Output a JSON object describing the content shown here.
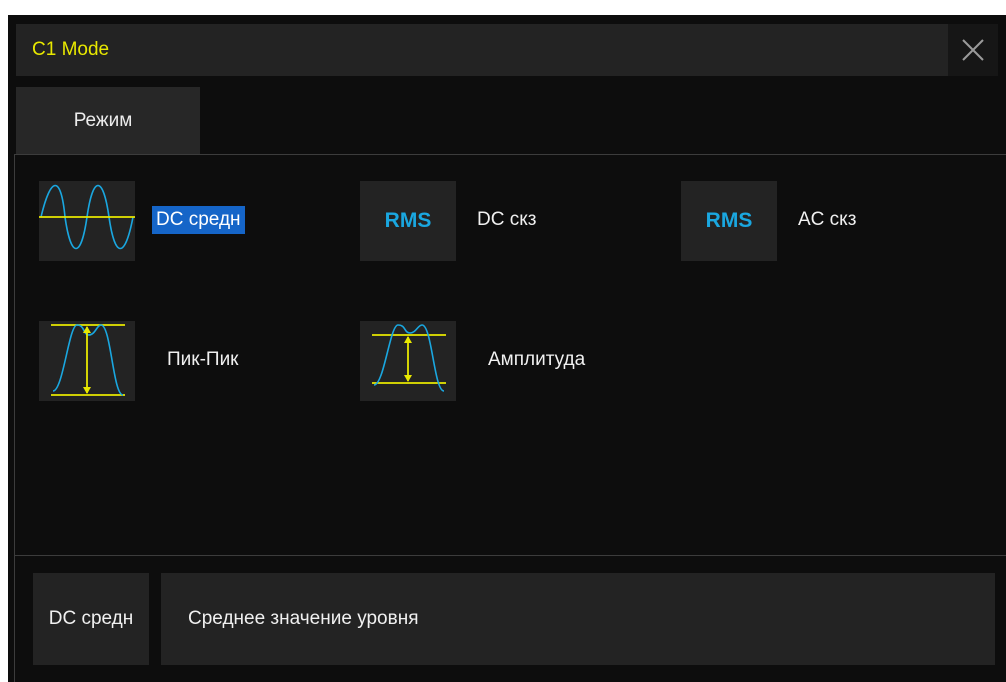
{
  "window": {
    "title": "C1 Mode",
    "close_icon": "close-icon"
  },
  "tabs": [
    {
      "label": "Режим",
      "active": true
    }
  ],
  "options": [
    {
      "label": "DC средн",
      "icon": "sine-wave-dc-icon",
      "selected": true
    },
    {
      "label": "DC скз",
      "icon": "RMS",
      "selected": false
    },
    {
      "label": "AC скз",
      "icon": "RMS",
      "selected": false
    },
    {
      "label": "Пик-Пик",
      "icon": "peak-to-peak-icon",
      "selected": false
    },
    {
      "label": "Амплитуда",
      "icon": "amplitude-icon",
      "selected": false
    }
  ],
  "info": {
    "name": "DC средн",
    "description": "Среднее значение уровня"
  },
  "colors": {
    "title": "#e8e800",
    "wave": "#1aa7e0",
    "marker": "#e8e800",
    "selection": "#1565c8"
  }
}
